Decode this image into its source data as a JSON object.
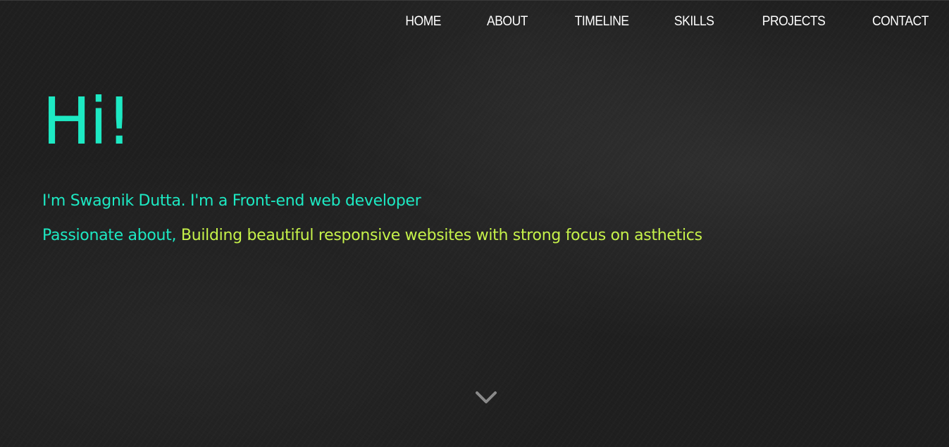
{
  "nav": {
    "items": [
      {
        "label": "HOME"
      },
      {
        "label": "ABOUT"
      },
      {
        "label": "TIMELINE"
      },
      {
        "label": "SKILLS"
      },
      {
        "label": "PROJECTS"
      },
      {
        "label": "CONTACT"
      }
    ]
  },
  "hero": {
    "greeting": "Hi!",
    "intro": "I'm Swagnik Dutta. I'm a Front-end web developer",
    "passion_prefix": "Passionate about, ",
    "passion_text": "Building beautiful responsive websites with strong focus on asthetics"
  },
  "scroll": {
    "icon": "chevron-down-icon"
  },
  "colors": {
    "accent_teal": "#1de9c3",
    "accent_lime": "#c6f24a",
    "background": "#1f1f1f",
    "nav_text": "#ffffff"
  }
}
